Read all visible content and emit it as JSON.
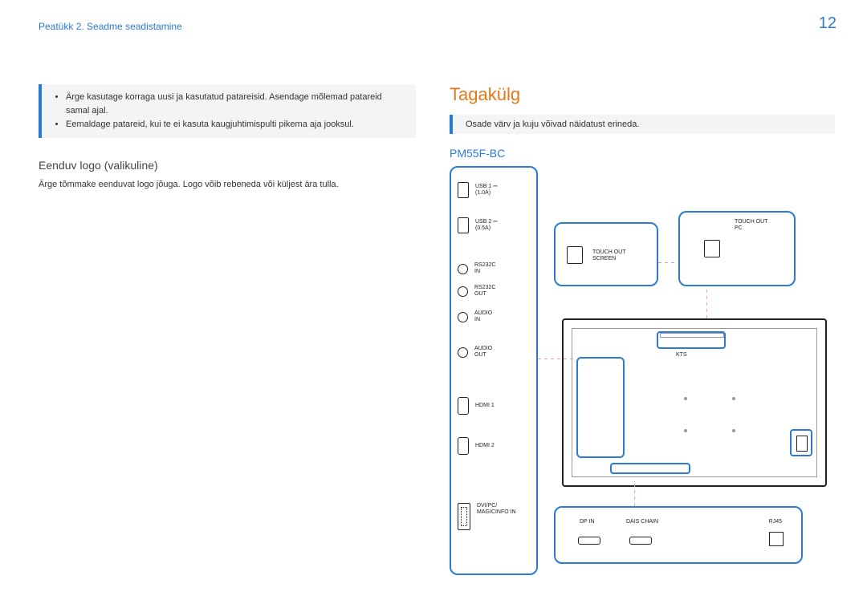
{
  "page_number": "12",
  "chapter": "Peatükk 2. Seadme seadistamine",
  "bullets": [
    "Ärge kasutage korraga uusi ja kasutatud patareisid. Asendage mõlemad patareid samal ajal.",
    "Eemaldage patareid, kui te ei kasuta kaugjuhtimispulti pikema aja jooksul."
  ],
  "logo_head": "Eenduv logo (valikuline)",
  "logo_para": "Ärge tõmmake eenduvat logo jõuga. Logo võib rebeneda või küljest ära tulla.",
  "section_title": "Tagakülg",
  "note": "Osade värv ja kuju võivad näidatust erineda.",
  "model": "PM55F-BC",
  "ports": {
    "usb1": "USB 1 ⎓\n(1.0A)",
    "usb2": "USB 2 ⎓\n(0.5A)",
    "rs_in": "RS232C\nIN",
    "rs_out": "RS232C\nOUT",
    "audio_in": "AUDIO\nIN",
    "audio_out": "AUDIO\nOUT",
    "hdmi1": "HDMI 1",
    "hdmi2": "HDMI 2",
    "dvi": "DVI/PC/\nMAGICINFO IN"
  },
  "touch_screen": "TOUCH OUT\nSCREEN",
  "touch_pc": "TOUCH OUT\nPC",
  "bottom": {
    "dpin": "DP IN",
    "daisy": "DAIS CHAIN",
    "rj45": "RJ45"
  },
  "tv_label": "KTS"
}
